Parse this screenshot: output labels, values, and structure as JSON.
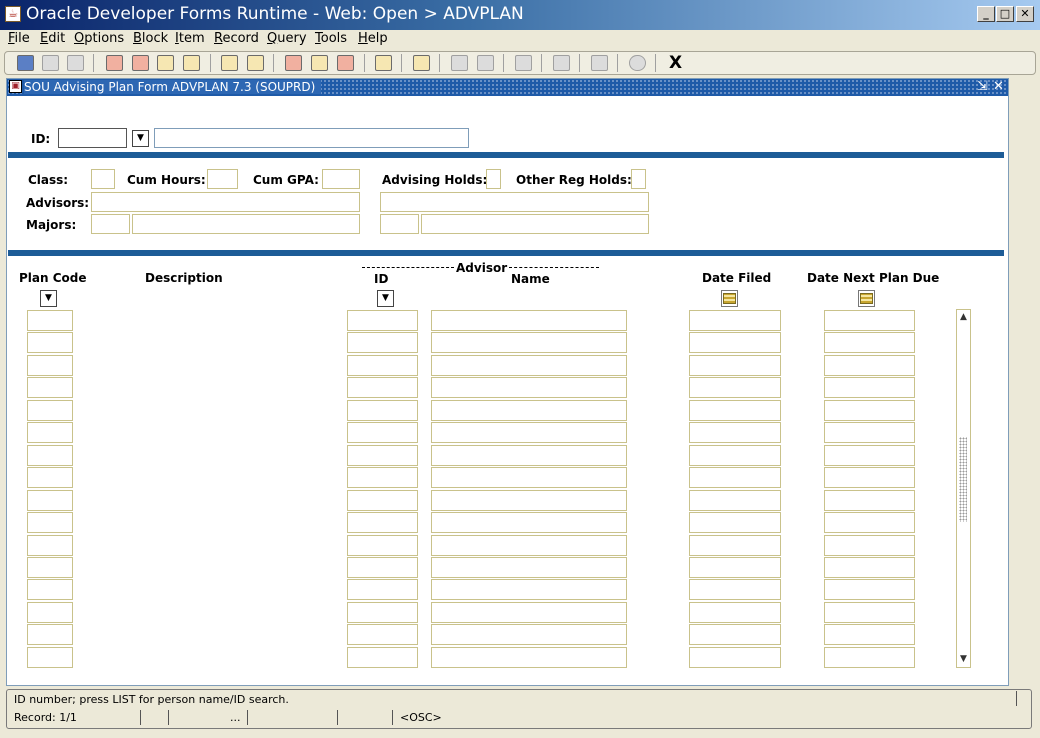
{
  "window": {
    "title": "Oracle Developer Forms Runtime - Web:  Open > ADVPLAN",
    "buttons": {
      "minimize": "_",
      "maximize": "□",
      "close": "✕"
    }
  },
  "menu": [
    {
      "u": "F",
      "rest": "ile"
    },
    {
      "u": "E",
      "rest": "dit"
    },
    {
      "u": "O",
      "rest": "ptions"
    },
    {
      "u": "B",
      "rest": "lock"
    },
    {
      "u": "I",
      "rest": "tem"
    },
    {
      "u": "R",
      "rest": "ecord"
    },
    {
      "u": "Q",
      "rest": "uery"
    },
    {
      "u": "T",
      "rest": "ools"
    },
    {
      "u": "H",
      "rest": "elp"
    }
  ],
  "toolbar": {
    "icons": [
      "save-icon",
      "rollback-icon",
      "print-form-icon",
      "insert-record-icon",
      "remove-record-icon",
      "previous-block-icon",
      "next-block-icon",
      "enter-query-icon",
      "execute-query-icon",
      "item-help-icon",
      "list-values-icon",
      "clear-record-icon",
      "duplicate-icon",
      "print-icon",
      "cut-icon",
      "copy-icon",
      "speaker-icon",
      "target-icon",
      "export-icon",
      "help-icon"
    ],
    "exit_label": "X"
  },
  "form": {
    "title": "SOU Advising Plan Form  ADVPLAN  7.3  (SOUPRD)",
    "id_label": "ID:",
    "class_label": "Class:",
    "cum_hours_label": "Cum Hours:",
    "cum_gpa_label": "Cum GPA:",
    "advising_holds_label": "Advising Holds:",
    "other_reg_holds_label": "Other Reg Holds:",
    "advisors_label": "Advisors:",
    "majors_label": "Majors:",
    "columns": {
      "plan_code": "Plan Code",
      "description": "Description",
      "advisor_group": "Advisor",
      "advisor_id": "ID",
      "advisor_name": "Name",
      "date_filed": "Date Filed",
      "date_next_plan_due": "Date Next Plan Due"
    },
    "row_count": 16
  },
  "status": {
    "message": "ID number; press LIST for person name/ID search.",
    "record": "Record: 1/1",
    "dots": "...",
    "mode": "<OSC>"
  },
  "colors": {
    "title_bar": "#0a246a",
    "form_title": "#1e5aa8",
    "blue_bar": "#1d5c97"
  }
}
